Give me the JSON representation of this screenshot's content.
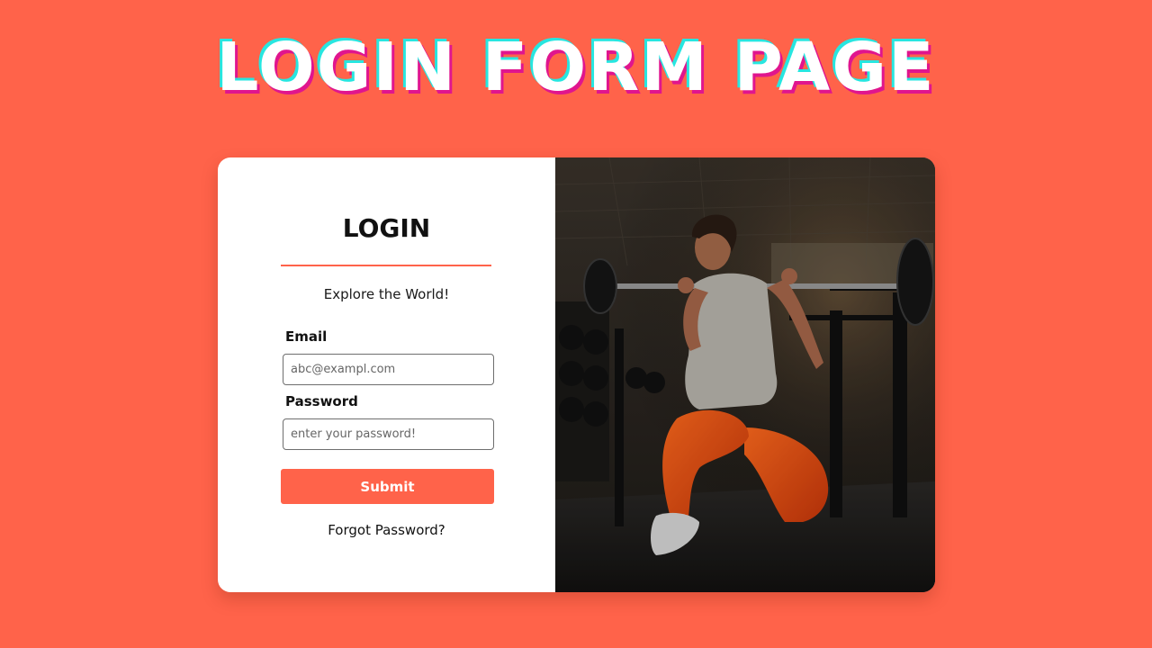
{
  "banner": {
    "title": "LOGIN FORM PAGE"
  },
  "form": {
    "heading": "LOGIN",
    "tagline": "Explore the World!",
    "email": {
      "label": "Email",
      "placeholder": "abc@exampl.com",
      "value": ""
    },
    "password": {
      "label": "Password",
      "placeholder": "enter your password!",
      "value": ""
    },
    "submit_label": "Submit",
    "forgot_label": "Forgot Password?"
  },
  "photo": {
    "subject": "woman doing barbell lunge in gym"
  },
  "colors": {
    "background": "#FF634A",
    "accent": "#FF634A",
    "card": "#FFFFFF",
    "title_shadow_cyan": "#27E6E0",
    "title_shadow_magenta": "#E0158E"
  }
}
